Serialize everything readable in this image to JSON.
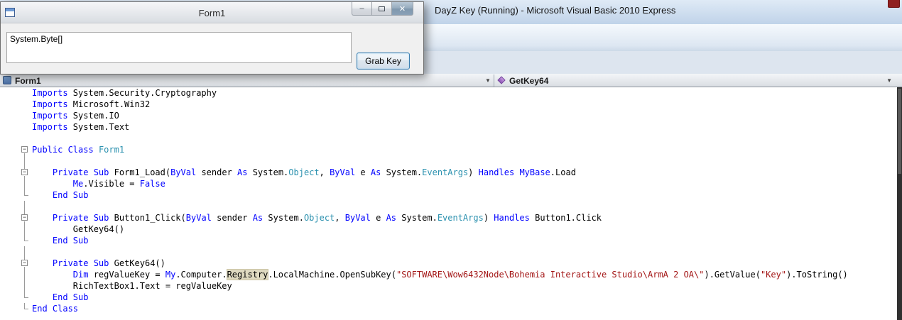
{
  "main_window": {
    "title": "DayZ Key (Running) - Microsoft Visual Basic 2010 Express"
  },
  "form_window": {
    "title": "Form1",
    "textbox_value": "System.Byte[]",
    "button_label": "Grab Key",
    "minimize_glyph": "–",
    "close_glyph": "✕"
  },
  "navbar": {
    "object_label": "Form1",
    "procedure_label": "GetKey64",
    "chevron_glyph": "▼"
  },
  "toolbar": {
    "items": [
      {
        "type": "icon",
        "name": "new-item-icon",
        "glyph": "▤",
        "color": "#5b7fa6"
      },
      {
        "type": "dropdown",
        "name": "toolbar-overflow-chevron",
        "glyph": "▾"
      },
      {
        "type": "sep"
      },
      {
        "type": "icon",
        "name": "navigate-forward-icon",
        "glyph": "➜",
        "color": "#a8642e"
      },
      {
        "type": "icon",
        "name": "solution-explorer-icon",
        "glyph": "▦",
        "color": "#49799c"
      },
      {
        "type": "icon",
        "name": "properties-window-icon",
        "glyph": "▣",
        "color": "#49799c"
      },
      {
        "type": "dropdown",
        "name": "window-list-chevron",
        "glyph": "▾"
      },
      {
        "type": "sep"
      },
      {
        "type": "icon",
        "name": "extension-manager-icon",
        "glyph": "◈",
        "color": "#b5731f"
      },
      {
        "type": "dropdown",
        "name": "tools-chevron",
        "glyph": "▾"
      }
    ]
  },
  "colors": {
    "keyword": "#0000FF",
    "type_name": "#2B91AF",
    "string_literal": "#A31515",
    "plain_text": "#000000",
    "reference_highlight": "#DED9C0",
    "titlebar": "#C5D6EA"
  },
  "editor": {
    "fold_collapse_glyph": "−",
    "lines": [
      {
        "g": "",
        "t": [
          [
            "Imports",
            "kw"
          ],
          [
            " System.Security.Cryptography",
            "pl"
          ]
        ]
      },
      {
        "g": "",
        "t": [
          [
            "Imports",
            "kw"
          ],
          [
            " Microsoft.Win32",
            "pl"
          ]
        ]
      },
      {
        "g": "",
        "t": [
          [
            "Imports",
            "kw"
          ],
          [
            " System.IO",
            "pl"
          ]
        ]
      },
      {
        "g": "",
        "t": [
          [
            "Imports",
            "kw"
          ],
          [
            " System.Text",
            "pl"
          ]
        ]
      },
      {
        "g": "",
        "t": []
      },
      {
        "g": "box",
        "t": [
          [
            "Public Class",
            "kw"
          ],
          [
            " ",
            "pl"
          ],
          [
            "Form1",
            "ty"
          ]
        ]
      },
      {
        "g": "line",
        "t": []
      },
      {
        "g": "boxline",
        "t": [
          [
            "    ",
            "pl"
          ],
          [
            "Private Sub",
            "kw"
          ],
          [
            " Form1_Load(",
            "pl"
          ],
          [
            "ByVal",
            "kw"
          ],
          [
            " sender ",
            "pl"
          ],
          [
            "As",
            "kw"
          ],
          [
            " System.",
            "pl"
          ],
          [
            "Object",
            "ty"
          ],
          [
            ", ",
            "pl"
          ],
          [
            "ByVal",
            "kw"
          ],
          [
            " e ",
            "pl"
          ],
          [
            "As",
            "kw"
          ],
          [
            " System.",
            "pl"
          ],
          [
            "EventArgs",
            "ty"
          ],
          [
            ") ",
            "pl"
          ],
          [
            "Handles",
            "kw"
          ],
          [
            " ",
            "pl"
          ],
          [
            "MyBase",
            "kw"
          ],
          [
            ".Load",
            "pl"
          ]
        ]
      },
      {
        "g": "line",
        "t": [
          [
            "        ",
            "pl"
          ],
          [
            "Me",
            "kw"
          ],
          [
            ".Visible = ",
            "pl"
          ],
          [
            "False",
            "kw"
          ]
        ]
      },
      {
        "g": "end",
        "t": [
          [
            "    ",
            "pl"
          ],
          [
            "End Sub",
            "kw"
          ]
        ]
      },
      {
        "g": "line",
        "t": []
      },
      {
        "g": "boxline",
        "t": [
          [
            "    ",
            "pl"
          ],
          [
            "Private Sub",
            "kw"
          ],
          [
            " Button1_Click(",
            "pl"
          ],
          [
            "ByVal",
            "kw"
          ],
          [
            " sender ",
            "pl"
          ],
          [
            "As",
            "kw"
          ],
          [
            " System.",
            "pl"
          ],
          [
            "Object",
            "ty"
          ],
          [
            ", ",
            "pl"
          ],
          [
            "ByVal",
            "kw"
          ],
          [
            " e ",
            "pl"
          ],
          [
            "As",
            "kw"
          ],
          [
            " System.",
            "pl"
          ],
          [
            "EventArgs",
            "ty"
          ],
          [
            ") ",
            "pl"
          ],
          [
            "Handles",
            "kw"
          ],
          [
            " Button1.Click",
            "pl"
          ]
        ]
      },
      {
        "g": "line",
        "t": [
          [
            "        GetKey64()",
            "pl"
          ]
        ]
      },
      {
        "g": "end",
        "t": [
          [
            "    ",
            "pl"
          ],
          [
            "End Sub",
            "kw"
          ]
        ]
      },
      {
        "g": "line",
        "t": []
      },
      {
        "g": "boxline",
        "t": [
          [
            "    ",
            "pl"
          ],
          [
            "Private Sub",
            "kw"
          ],
          [
            " GetKey64()",
            "pl"
          ]
        ]
      },
      {
        "g": "line",
        "t": [
          [
            "        ",
            "pl"
          ],
          [
            "Dim",
            "kw"
          ],
          [
            " regValueKey = ",
            "pl"
          ],
          [
            "My",
            "kw"
          ],
          [
            ".Computer.",
            "pl"
          ],
          [
            "Registry",
            "hl"
          ],
          [
            ".LocalMachine.OpenSubKey(",
            "pl"
          ],
          [
            "\"SOFTWARE\\Wow6432Node\\Bohemia Interactive Studio\\ArmA 2 OA\\\"",
            "st"
          ],
          [
            ").GetValue(",
            "pl"
          ],
          [
            "\"Key\"",
            "st"
          ],
          [
            ").ToString()",
            "pl"
          ]
        ]
      },
      {
        "g": "line",
        "t": [
          [
            "        RichTextBox1.Text = regValueKey",
            "pl"
          ]
        ]
      },
      {
        "g": "end",
        "t": [
          [
            "    ",
            "pl"
          ],
          [
            "End Sub",
            "kw"
          ]
        ]
      },
      {
        "g": "end",
        "t": [
          [
            "End Class",
            "kw"
          ]
        ]
      }
    ]
  }
}
